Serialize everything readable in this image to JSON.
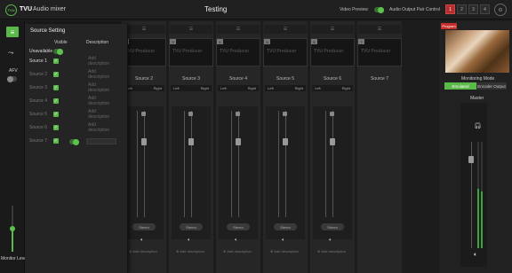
{
  "header": {
    "logo": "TVU",
    "brand": "TVU",
    "app_title": "Audio mixer",
    "center_title": "Testing",
    "video_preview_label": "Video Preview",
    "audio_output_pair_label": "Audio Output Pair Control",
    "pair_buttons": [
      "1",
      "2",
      "3",
      "4"
    ]
  },
  "rail": {
    "afv_label": "AFV",
    "monitor_levels_label": "Monitor Levels"
  },
  "panel": {
    "title": "Source Setting",
    "col_visible": "Visible",
    "col_description": "Description",
    "unavailable_label": "Unavailable",
    "rows": [
      {
        "label": "Source 1",
        "desc": "Add description"
      },
      {
        "label": "Source 2",
        "desc": "Add description"
      },
      {
        "label": "Source 3",
        "desc": "Add description"
      },
      {
        "label": "Source 4",
        "desc": "Add description"
      },
      {
        "label": "Source 5",
        "desc": "Add description"
      },
      {
        "label": "Source 6",
        "desc": "Add description"
      },
      {
        "label": "Source 7",
        "desc": ""
      }
    ]
  },
  "strips": [
    {
      "num": "2",
      "name": "Source 2",
      "logo": "TVU Producer",
      "left": "Left",
      "right": "Right",
      "pill": "Stereo",
      "add_desc": "Add description"
    },
    {
      "num": "3",
      "name": "Source 3",
      "logo": "TVU Producer",
      "left": "Left",
      "right": "Right",
      "pill": "Stereo",
      "add_desc": "Add description"
    },
    {
      "num": "4",
      "name": "Source 4",
      "logo": "TVU Producer",
      "left": "Left",
      "right": "Right",
      "pill": "Stereo",
      "add_desc": "Add description"
    },
    {
      "num": "5",
      "name": "Source 5",
      "logo": "TVU Producer",
      "left": "Left",
      "right": "Right",
      "pill": "Stereo",
      "add_desc": "Add description"
    },
    {
      "num": "6",
      "name": "Source 6",
      "logo": "TVU Producer",
      "left": "Left",
      "right": "Right",
      "pill": "Stereo",
      "add_desc": "Add description"
    },
    {
      "num": "7",
      "name": "Source 7",
      "logo": "TVU Producer"
    }
  ],
  "right": {
    "program_tag": "Program",
    "monitoring_mode_label": "Monitoring Mode",
    "mode_embedded": "Emulated",
    "mode_encoder": "Encoder Output",
    "master_label": "Master"
  },
  "icons": {
    "menu": "menu-icon",
    "routing": "routing-icon",
    "gear": "gear-icon",
    "speaker": "speaker-icon",
    "headphones": "headphones-icon"
  },
  "colors": {
    "accent": "#5bb84a",
    "program": "#c62e2e"
  }
}
